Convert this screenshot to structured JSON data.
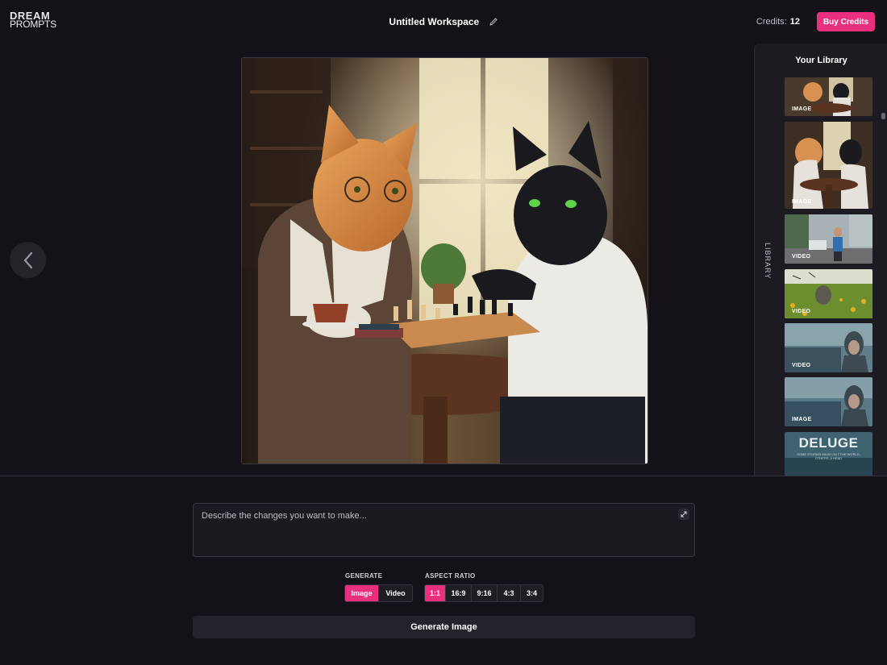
{
  "brand": {
    "line1": "DREAM",
    "line2": "PROMPTS"
  },
  "workspace": {
    "title": "Untitled Workspace"
  },
  "account": {
    "credits_label": "Credits:",
    "credits_value": "12",
    "buy_label": "Buy Credits"
  },
  "library": {
    "title": "Your Library",
    "side_label": "LIBRARY",
    "items": [
      {
        "badge": "IMAGE"
      },
      {
        "badge": "IMAGE"
      },
      {
        "badge": "VIDEO"
      },
      {
        "badge": "VIDEO"
      },
      {
        "badge": "VIDEO"
      },
      {
        "badge": "IMAGE"
      },
      {
        "title": "DELUGE",
        "subtitle": "SOME STORMS WASH OUT THE WORLD, OTHERS, A HEAD"
      }
    ]
  },
  "prompt": {
    "placeholder": "Describe the changes you want to make..."
  },
  "generate": {
    "label": "GENERATE",
    "options": [
      "Image",
      "Video"
    ],
    "selected": "Image"
  },
  "aspect_ratio": {
    "label": "ASPECT RATIO",
    "options": [
      "1:1",
      "16:9",
      "9:16",
      "4:3",
      "3:4"
    ],
    "selected": "1:1"
  },
  "action": {
    "label": "Generate Image"
  },
  "colors": {
    "accent": "#e8307f",
    "background": "#141218",
    "panel": "#1d1b22"
  },
  "icons": [
    "pencil-icon",
    "chevron-left-icon",
    "expand-icon"
  ]
}
